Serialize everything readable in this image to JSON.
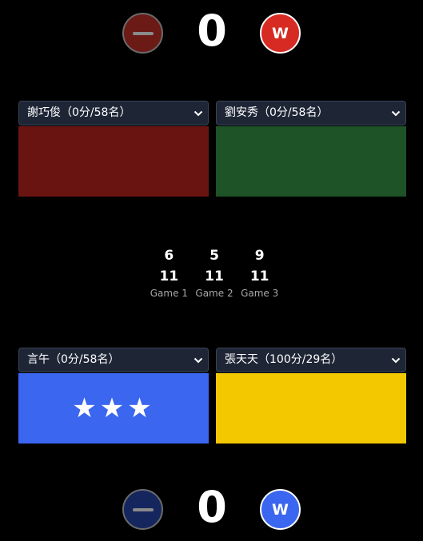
{
  "top_score": {
    "minus_icon": "minus-icon",
    "score": "0",
    "w_label": "W",
    "minus_color": "#6b1a16",
    "w_color": "#d62a22"
  },
  "top_teams": {
    "left": {
      "player": "謝巧俊（0分/58名）",
      "color": "#6a1412"
    },
    "right": {
      "player": "劉安秀（0分/58名）",
      "color": "#1e5227"
    }
  },
  "games": [
    {
      "top": "6",
      "bottom": "11",
      "label": "Game 1"
    },
    {
      "top": "5",
      "bottom": "11",
      "label": "Game 2"
    },
    {
      "top": "9",
      "bottom": "11",
      "label": "Game 3"
    }
  ],
  "bottom_teams": {
    "left": {
      "player": "言午（0分/58名）",
      "color": "#3b66ef",
      "stars": "★★★"
    },
    "right": {
      "player": "張天天（100分/29名）",
      "color": "#f4c800"
    }
  },
  "bottom_score": {
    "minus_icon": "minus-icon",
    "score": "0",
    "w_label": "W",
    "minus_color": "#15265e",
    "w_color": "#3b66ef"
  }
}
